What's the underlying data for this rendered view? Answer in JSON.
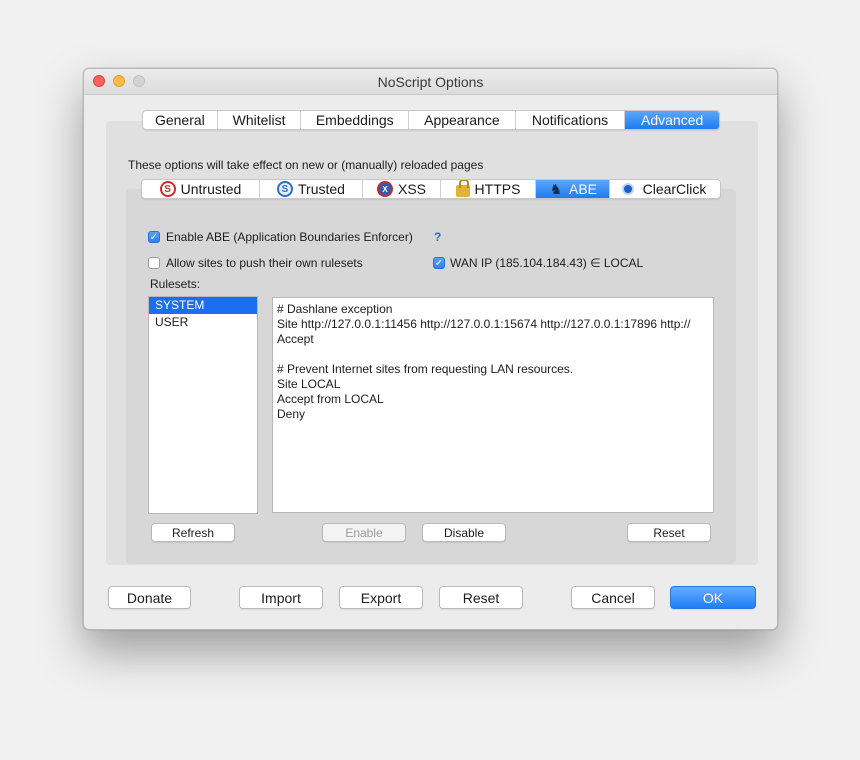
{
  "window": {
    "title": "NoScript Options"
  },
  "main_tabs": [
    {
      "label": "General"
    },
    {
      "label": "Whitelist"
    },
    {
      "label": "Embeddings"
    },
    {
      "label": "Appearance"
    },
    {
      "label": "Notifications"
    },
    {
      "label": "Advanced",
      "active": true
    }
  ],
  "info_text": "These options will take effect on new or (manually) reloaded pages",
  "sub_tabs": [
    {
      "label": "Untrusted",
      "icon": "untrusted-icon"
    },
    {
      "label": "Trusted",
      "icon": "trusted-icon"
    },
    {
      "label": "XSS",
      "icon": "xss-icon"
    },
    {
      "label": "HTTPS",
      "icon": "lock-icon"
    },
    {
      "label": "ABE",
      "icon": "abe-icon",
      "active": true
    },
    {
      "label": "ClearClick",
      "icon": "clearclick-icon"
    }
  ],
  "options": {
    "enable_abe": {
      "label": "Enable ABE (Application Boundaries Enforcer)",
      "checked": true,
      "help": "?"
    },
    "allow_push": {
      "label": "Allow sites to push their own rulesets",
      "checked": false
    },
    "wan_ip": {
      "label": "WAN IP (185.104.184.43) ∈ LOCAL",
      "checked": true
    }
  },
  "rulesets": {
    "label": "Rulesets:",
    "items": [
      {
        "label": "SYSTEM",
        "selected": true
      },
      {
        "label": "USER",
        "selected": false
      }
    ]
  },
  "editor": {
    "lines": [
      "# Dashlane exception",
      "Site http://127.0.0.1:11456 http://127.0.0.1:15674 http://127.0.0.1:17896 http://",
      "Accept",
      "",
      "# Prevent Internet sites from requesting LAN resources.",
      "Site LOCAL",
      "Accept from LOCAL",
      "Deny"
    ]
  },
  "ruleset_buttons": {
    "refresh": "Refresh",
    "enable": "Enable",
    "disable": "Disable",
    "reset": "Reset"
  },
  "footer_buttons": {
    "donate": "Donate",
    "import": "Import",
    "export": "Export",
    "reset": "Reset",
    "cancel": "Cancel",
    "ok": "OK"
  },
  "colors": {
    "accent": "#1c6ef0",
    "close": "#fc605b",
    "minimize": "#fdbc40"
  }
}
